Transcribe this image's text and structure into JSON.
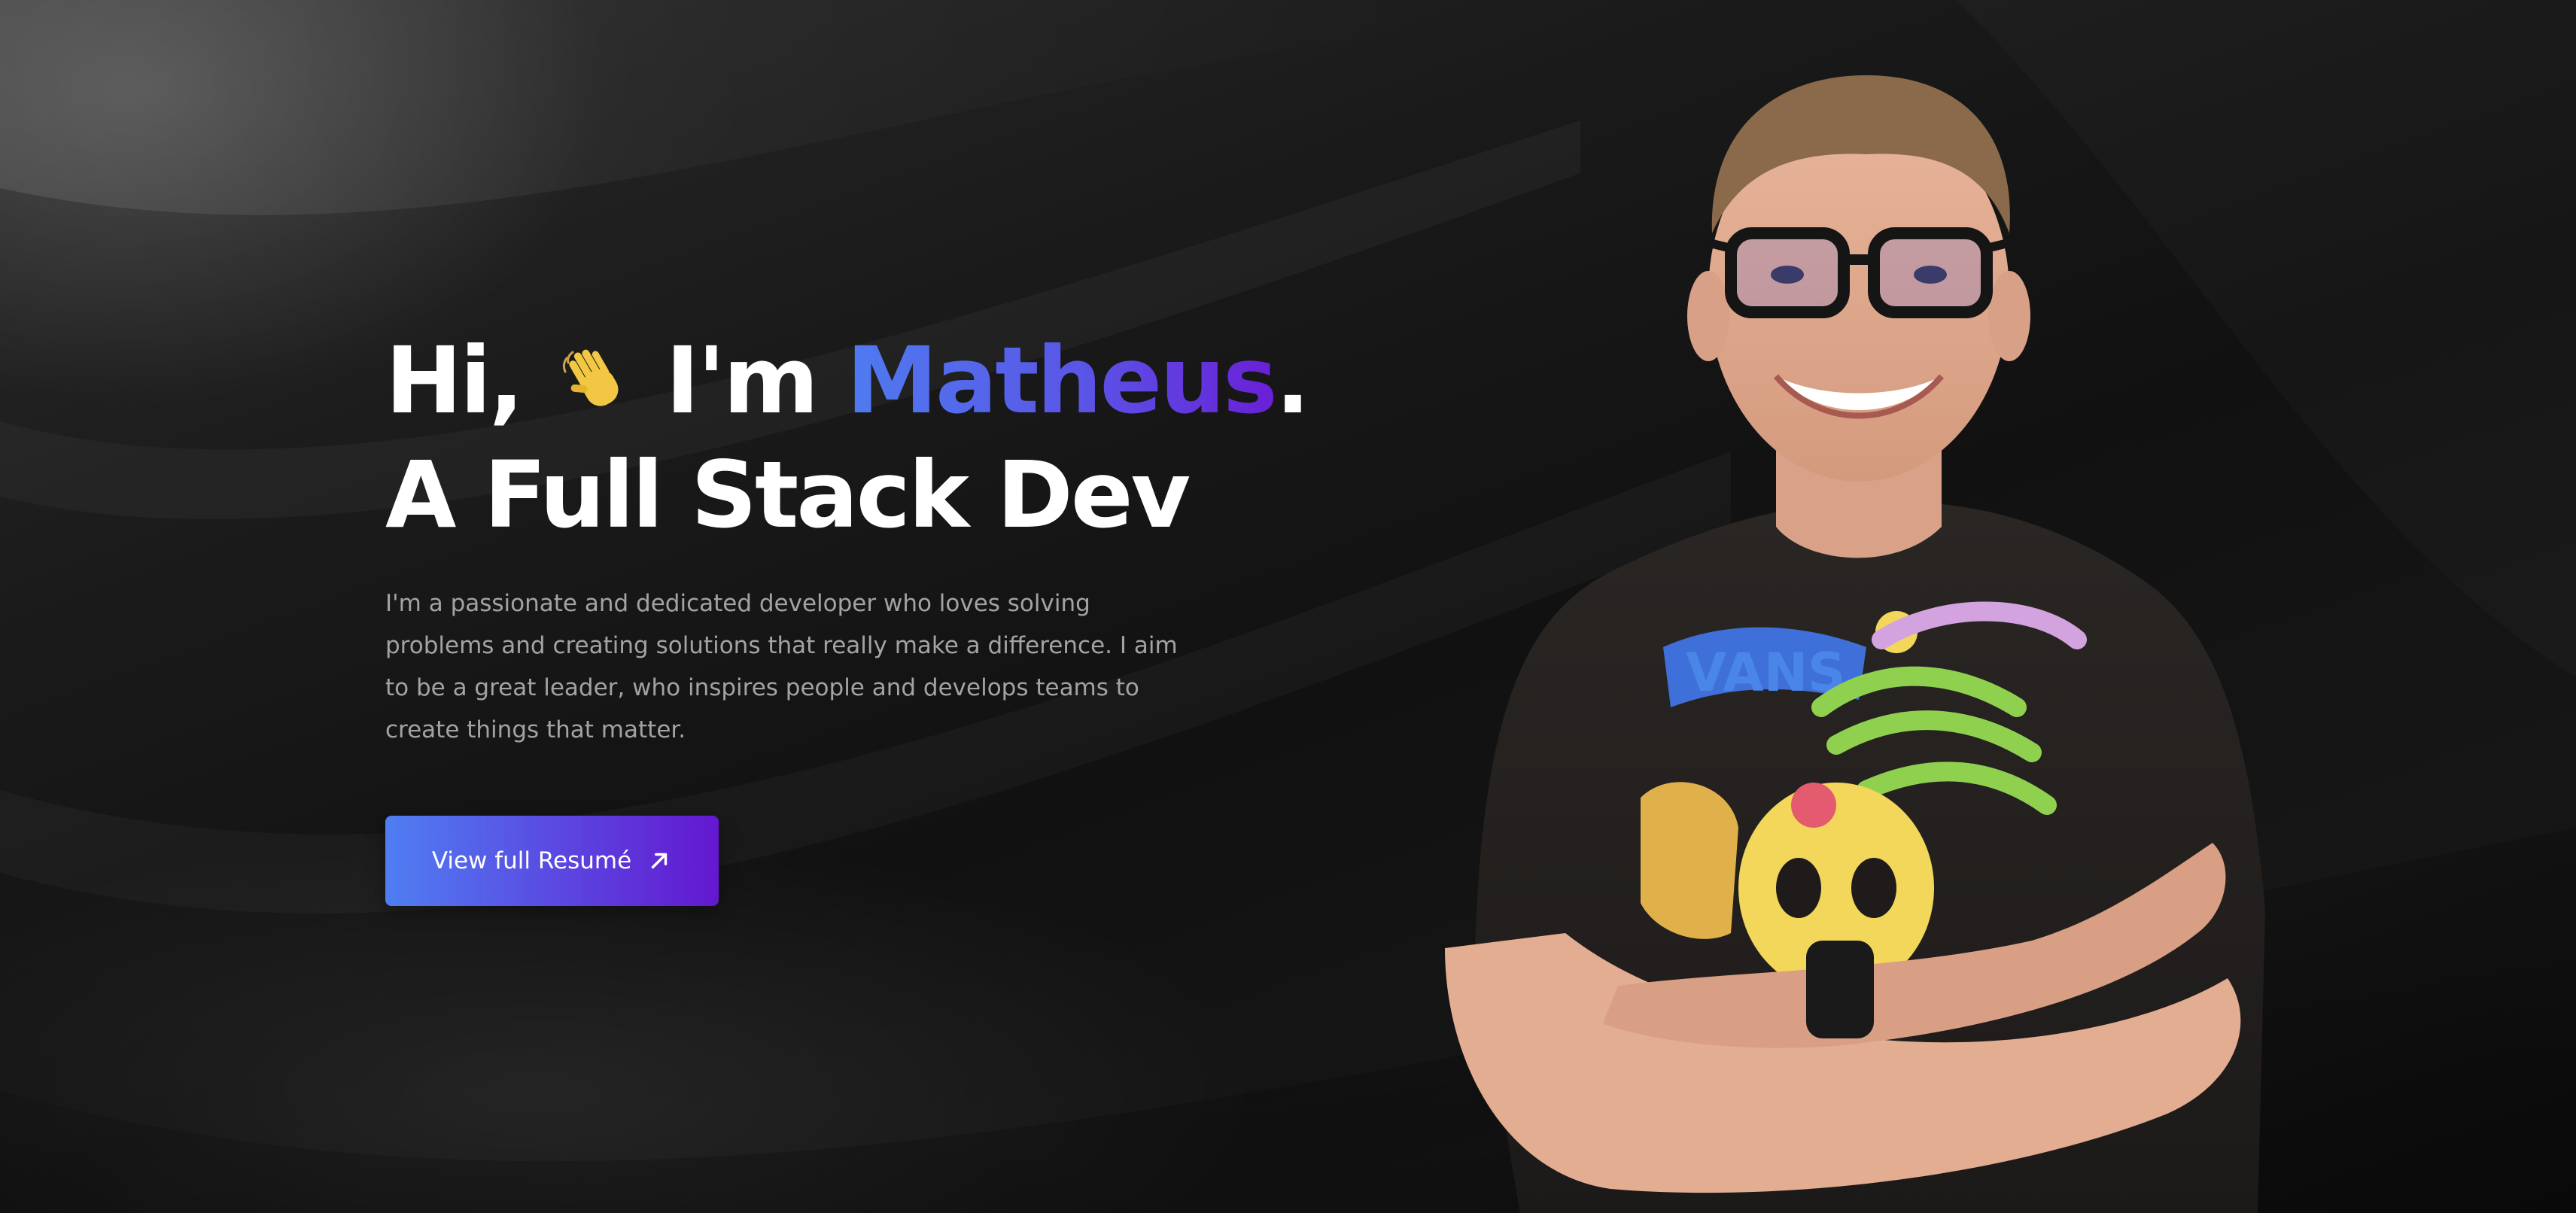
{
  "hero": {
    "greeting": "Hi,",
    "intro": "I'm",
    "name": "Matheus",
    "period": ".",
    "role": "A Full Stack Dev",
    "description": "I'm a passionate and dedicated developer who loves solving problems and creating solutions that really make a difference. I aim to be a great leader, who inspires people and develops teams to create things that matter.",
    "cta_label": "View full Resumé",
    "wave_icon": "waving-hand-icon",
    "cta_icon": "arrow-up-right-icon",
    "portrait_shirt_text": "VANS"
  },
  "colors": {
    "background": "#141414",
    "name_gradient_start": "#4f7bf0",
    "name_gradient_end": "#6a1fd6",
    "button_gradient_start": "#4f7ef2",
    "button_gradient_end": "#6318cf",
    "text_primary": "#ffffff",
    "text_secondary": "#a3a3a3"
  }
}
